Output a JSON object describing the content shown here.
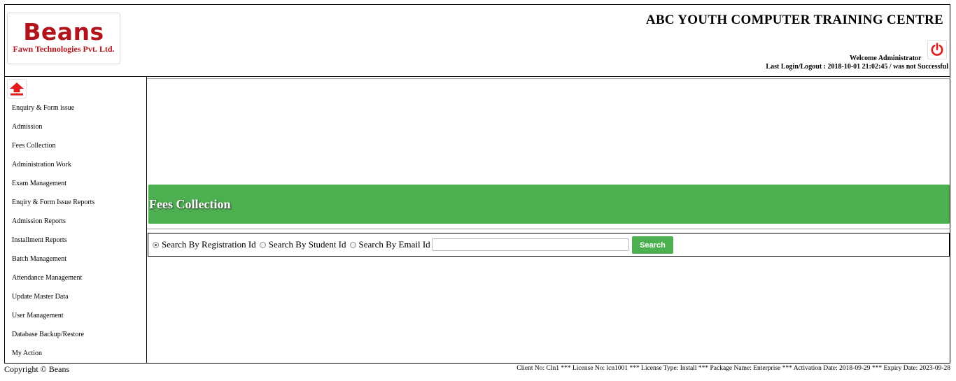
{
  "header": {
    "logo_main": "Beans",
    "logo_sub": "Fawn Technologies Pvt. Ltd.",
    "org_title": "ABC YOUTH COMPUTER TRAINING CENTRE",
    "welcome": "Welcome Administrator",
    "last_login": "Last Login/Logout : 2018-10-01 21:02:45 / was not Successful",
    "power_icon": "power-icon"
  },
  "sidebar": {
    "up_icon": "arrow-up-icon",
    "items": [
      "Enquiry & Form issue",
      "Admission",
      "Fees Collection",
      "Administration Work",
      "Exam Management",
      "Enqiry & Form Issue Reports",
      "Admission Reports",
      "Installment Reports",
      "Batch Management",
      "Attendance Management",
      "Update Master Data",
      "User Management",
      "Database Backup/Restore",
      "My Action"
    ]
  },
  "main": {
    "section_title": "Fees Collection",
    "search": {
      "options": [
        {
          "label": "Search By Registration Id",
          "checked": true
        },
        {
          "label": "Search By Student Id",
          "checked": false
        },
        {
          "label": "Search By Email Id",
          "checked": false
        }
      ],
      "input_value": "",
      "input_placeholder": "",
      "button_label": "Search"
    }
  },
  "footer": {
    "copyright": "Copyright © Beans",
    "license": "Client No: Cln1 *** License No: lcn1001 *** License Type: Install *** Package Name: Enterprise *** Activation Date: 2018-09-29 *** Expiry Date: 2023-09-28"
  },
  "colors": {
    "brand_red": "#b3131b",
    "accent_green": "#4caf50",
    "icon_red": "#e21b1b"
  }
}
